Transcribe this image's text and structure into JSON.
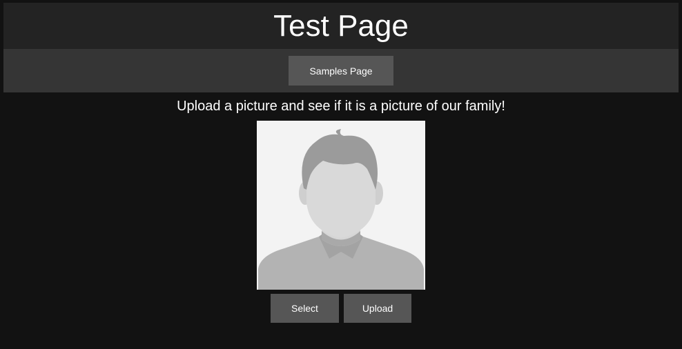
{
  "header": {
    "title": "Test Page"
  },
  "nav": {
    "samples_label": "Samples Page"
  },
  "main": {
    "instructions": "Upload a picture and see if it is a picture of our family!",
    "avatar_icon": "person-placeholder-icon",
    "select_label": "Select",
    "upload_label": "Upload"
  },
  "colors": {
    "background": "#121212",
    "header_bg": "#232323",
    "nav_bg": "#353535",
    "button_bg": "#565656",
    "avatar_bg": "#f3f3f3"
  }
}
